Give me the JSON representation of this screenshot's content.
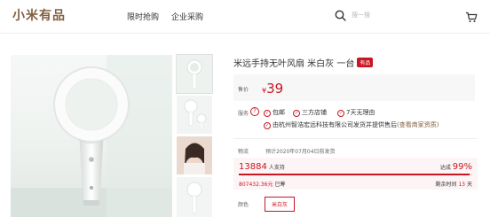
{
  "header": {
    "logo": "小米有品",
    "nav": [
      "限时抢购",
      "企业采购"
    ],
    "search_placeholder": "搜一搜"
  },
  "product": {
    "title": "米远手持无叶风扇 米白灰 一台",
    "badge": "有品",
    "price_label": "售价",
    "currency": "¥",
    "price": "39",
    "service_label": "服务",
    "services": [
      "包邮",
      "三方店铺",
      "7天无理由"
    ],
    "service_seller": "由杭州智浩宏远科技有限公司发货并提供售后",
    "service_link": "(查看商家资质)",
    "logistics_label": "物流",
    "logistics_value": "预计2020年07月04日前发货",
    "supporters": "13884",
    "supporters_label": "人支持",
    "reach_label": "达成",
    "reach_pct": "99%",
    "reach_fraction": 0.99,
    "raised": "807432.36元",
    "raised_label": "已筹",
    "remaining_label": "剩余时间",
    "remaining_days": "13",
    "remaining_unit": "天",
    "color_label": "颜色",
    "color_option": "米白灰"
  },
  "colors": {
    "accent": "#c81623",
    "brand": "#845f3f"
  }
}
